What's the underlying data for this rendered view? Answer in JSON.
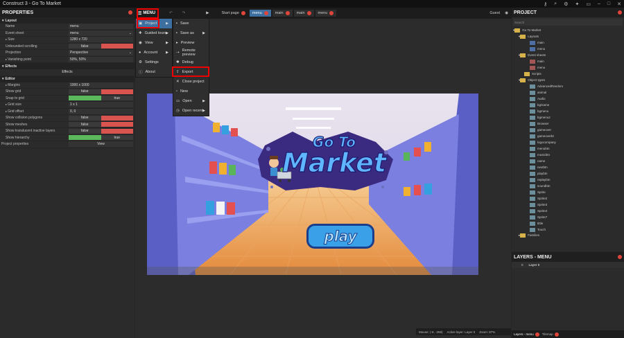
{
  "window": {
    "title": "Construct 3 - Go To Market"
  },
  "toolbar": {
    "menu_label": "MENU",
    "guest_label": "Guest",
    "start_page": "Start page",
    "tabs": [
      {
        "label": "menu",
        "active": true
      },
      {
        "label": "main",
        "active": false
      },
      {
        "label": "main",
        "active": false
      },
      {
        "label": "menu",
        "active": false
      }
    ]
  },
  "menu_main": {
    "items": [
      {
        "label": "Project",
        "icon": "project-icon",
        "has_submenu": true,
        "highlighted": true
      },
      {
        "label": "Guided tours",
        "icon": "guided-tours-icon",
        "has_submenu": true
      },
      {
        "label": "View",
        "icon": "view-icon",
        "has_submenu": true
      },
      {
        "label": "Account",
        "icon": "account-icon",
        "has_submenu": true
      },
      {
        "label": "Settings",
        "icon": "settings-icon",
        "has_submenu": false
      },
      {
        "label": "About",
        "icon": "about-icon",
        "has_submenu": false
      }
    ]
  },
  "menu_project": {
    "items": [
      {
        "label": "Save",
        "has_submenu": false
      },
      {
        "label": "Save as",
        "has_submenu": true
      },
      {
        "label": "Preview",
        "has_submenu": false
      },
      {
        "label": "Remote preview",
        "has_submenu": false
      },
      {
        "label": "Debug",
        "has_submenu": false
      },
      {
        "label": "Export",
        "has_submenu": false
      },
      {
        "label": "Close project",
        "has_submenu": false
      },
      {
        "label": "New",
        "has_submenu": false
      },
      {
        "label": "Open",
        "has_submenu": true
      },
      {
        "label": "Open recent",
        "has_submenu": true
      }
    ]
  },
  "properties": {
    "title": "PROPERTIES",
    "layout_section": "Layout",
    "name_label": "Name",
    "name_value": "menu",
    "event_sheet_label": "Event sheet",
    "event_sheet_value": "menu",
    "size_label": "Size",
    "size_value": "1280 x 720",
    "unbounded_label": "Unbounded scrolling",
    "unbounded_value": "false",
    "projection_label": "Projection",
    "projection_value": "Perspective",
    "vanishing_label": "Vanishing point",
    "vanishing_value": "50%, 50%",
    "effects_section": "Effects",
    "effects_button": "Effects",
    "editor_section": "Editor",
    "margins_label": "Margins",
    "margins_value": "1000 x 1000",
    "show_grid_label": "Show grid",
    "show_grid_value": "false",
    "snap_label": "Snap to grid",
    "snap_value": "true",
    "grid_size_label": "Grid size",
    "grid_size_value": "1 x 1",
    "grid_offset_label": "Grid offset",
    "grid_offset_value": "0, 0",
    "collision_label": "Show collision polygons",
    "collision_value": "false",
    "meshes_label": "Show meshes",
    "meshes_value": "false",
    "translucent_label": "Show translucent inactive layers",
    "translucent_value": "false",
    "hierarchy_label": "Show hierarchy",
    "hierarchy_value": "true",
    "project_props_label": "Project properties",
    "project_props_value": "View"
  },
  "game": {
    "logo_line1": "Go To",
    "logo_line2": "Market",
    "play_label": "play"
  },
  "status": {
    "mouse": "Mouse: (-8, -268)",
    "active_layer": "Active layer: Layer 0",
    "zoom": "Zoom: 87%"
  },
  "project": {
    "title": "PROJECT",
    "search_placeholder": "Search",
    "root": "Go To Market",
    "layouts_folder": "Layouts",
    "layouts": [
      "main",
      "menu"
    ],
    "event_sheets_folder": "Event sheets",
    "event_sheets": [
      "main",
      "menu"
    ],
    "scripts_folder": "Scripts",
    "object_types_folder": "Object types",
    "object_types": [
      "AdvancedRandom",
      "animal",
      "Audio",
      "bgGame",
      "bgmenu",
      "bgmenu2",
      "Browser",
      "gameover",
      "gameoverbt",
      "logocompany",
      "menubtn",
      "musicbtn",
      "name",
      "nextbtn",
      "playbtn",
      "replaybtn",
      "soundbtn",
      "Sprite",
      "Sprite2",
      "Sprite3",
      "Sprite4",
      "Sprite7",
      "tittle",
      "Touch"
    ],
    "families_folder": "Families"
  },
  "layers": {
    "title": "LAYERS - MENU",
    "layer_index": "0",
    "layer_name": "Layer 0",
    "bottom_tab1": "Layers - menu",
    "bottom_tab2": "Tilemap"
  }
}
